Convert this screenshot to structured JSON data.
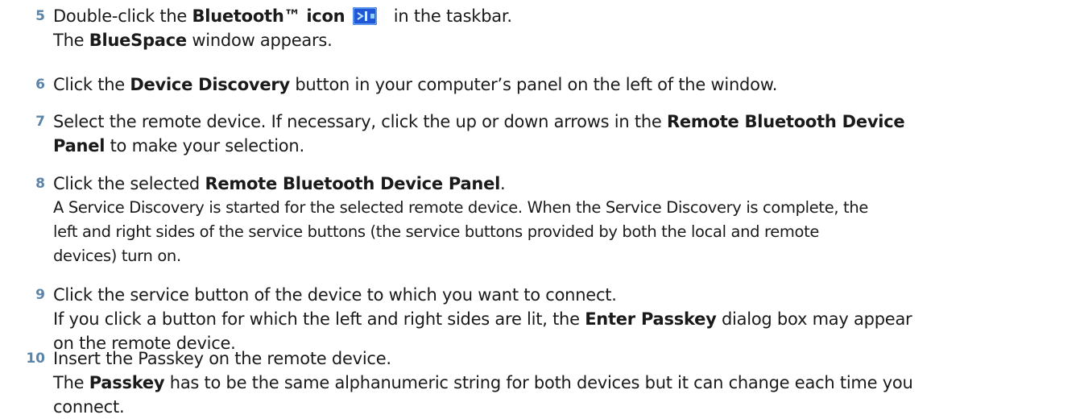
{
  "steps": [
    {
      "number": "5",
      "lines": [
        [
          "Double-click the ",
          {
            "b": "Bluetooth™ icon"
          },
          {
            "icon": "bluetooth-taskbar-icon"
          },
          " in the taskbar."
        ],
        [
          "The ",
          {
            "b": "BlueSpace"
          },
          " window appears."
        ]
      ]
    },
    {
      "number": "6",
      "lines": [
        [
          "Click the ",
          {
            "b": "Device Discovery"
          },
          " button in your computer’s panel on the left of the window."
        ]
      ]
    },
    {
      "number": "7",
      "lines": [
        [
          "Select the remote device. If necessary, click the up or down arrows in the ",
          {
            "b": "Remote Bluetooth Device"
          }
        ],
        [
          {
            "b": "Panel"
          },
          " to make your selection."
        ]
      ]
    },
    {
      "number": "8",
      "lines": [
        [
          "Click the selected ",
          {
            "b": "Remote Bluetooth Device Panel"
          },
          "."
        ],
        [
          {
            "d": "A Service Discovery is started for the selected remote device. When the Service Discovery is complete, the"
          }
        ],
        [
          "left and right sides of the service buttons (the service buttons provided by both the local and remote"
        ],
        [
          "devices) turn on."
        ]
      ]
    },
    {
      "number": "9",
      "lines": [
        [
          "Click the service button of the device to which you want to connect."
        ],
        [
          "If you click a button for which the left and right sides are lit, the ",
          {
            "b": "Enter Passkey"
          },
          " dialog box may appear"
        ],
        [
          "on the remote device."
        ]
      ]
    },
    {
      "number": "10",
      "lines": [
        [
          "Insert the Passkey on the remote device."
        ],
        [
          "The ",
          {
            "b": "Passkey"
          },
          " has to be the same alphanumeric string for both devices but it can change each time you"
        ],
        [
          "connect."
        ]
      ]
    }
  ],
  "icon_colors": {
    "bluetooth_icon_fill": "#1f57d6",
    "bluetooth_icon_accent": "#8fd0ff",
    "step_number_color": "#5b84a8"
  }
}
